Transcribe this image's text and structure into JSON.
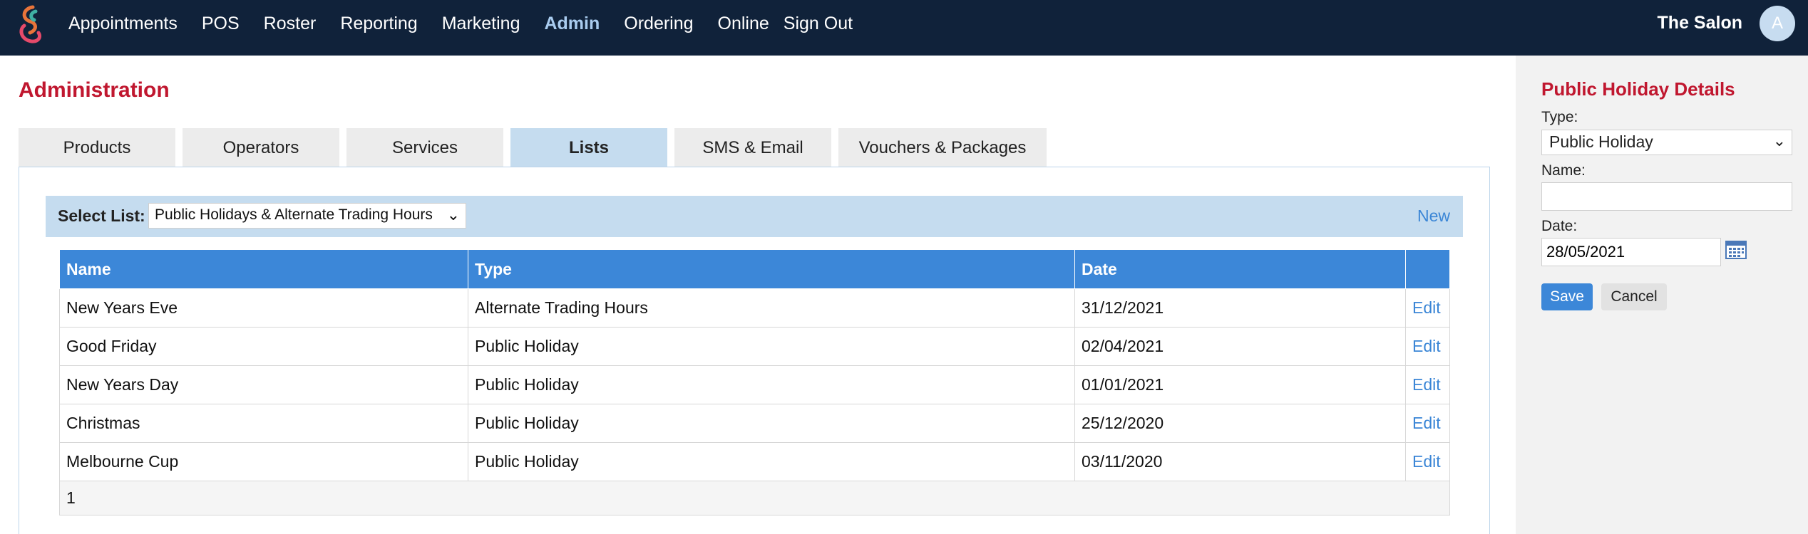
{
  "nav": {
    "items": [
      "Appointments",
      "POS",
      "Roster",
      "Reporting",
      "Marketing",
      "Admin",
      "Ordering",
      "Online",
      "Sign Out"
    ],
    "active": "Admin",
    "salon_name": "The Salon",
    "avatar_initial": "A"
  },
  "page": {
    "title": "Administration"
  },
  "tabs": [
    "Products",
    "Operators",
    "Services",
    "Lists",
    "SMS & Email",
    "Vouchers & Packages"
  ],
  "active_tab": "Lists",
  "select_list": {
    "label": "Select List:",
    "value": "Public Holidays & Alternate Trading Hours",
    "new_label": "New"
  },
  "table": {
    "headers": [
      "Name",
      "Type",
      "Date",
      ""
    ],
    "rows": [
      {
        "name": "New Years Eve",
        "type": "Alternate Trading Hours",
        "date": "31/12/2021",
        "action": "Edit"
      },
      {
        "name": "Good Friday",
        "type": "Public Holiday",
        "date": "02/04/2021",
        "action": "Edit"
      },
      {
        "name": "New Years Day",
        "type": "Public Holiday",
        "date": "01/01/2021",
        "action": "Edit"
      },
      {
        "name": "Christmas",
        "type": "Public Holiday",
        "date": "25/12/2020",
        "action": "Edit"
      },
      {
        "name": "Melbourne Cup",
        "type": "Public Holiday",
        "date": "03/11/2020",
        "action": "Edit"
      }
    ],
    "page": "1"
  },
  "details": {
    "title": "Public Holiday Details",
    "type_label": "Type:",
    "type_value": "Public Holiday",
    "name_label": "Name:",
    "name_value": "",
    "date_label": "Date:",
    "date_value": "28/05/2021",
    "save_label": "Save",
    "cancel_label": "Cancel"
  },
  "colors": {
    "nav_bg": "#10223a",
    "accent_red": "#c0172f",
    "accent_blue": "#3c87d8",
    "light_blue": "#c5dcef"
  },
  "icons": [
    "app-logo-icon",
    "chevron-down-icon",
    "calendar-icon"
  ]
}
